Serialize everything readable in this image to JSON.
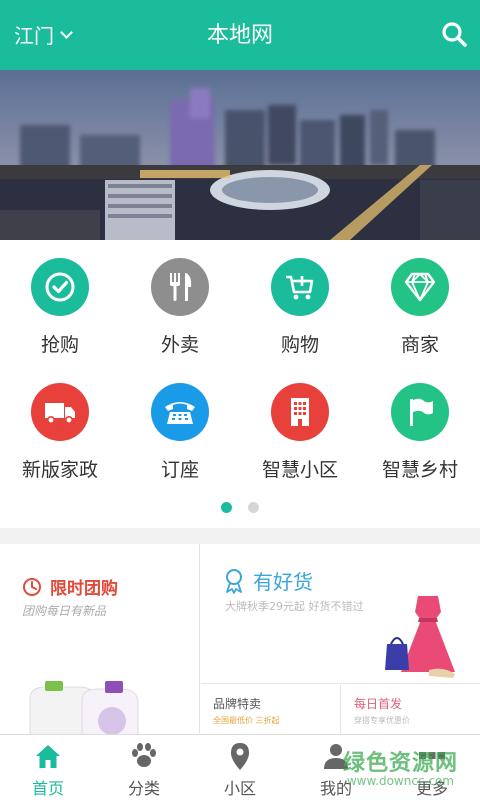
{
  "header": {
    "city": "江门",
    "title": "本地网",
    "bg_color": "#1bbc9b",
    "search_icon": "search-icon"
  },
  "categories": [
    {
      "label": "抢购",
      "icon": "check-icon",
      "color": "#1bbc9b"
    },
    {
      "label": "外卖",
      "icon": "fork-knife-icon",
      "color": "#8e8e8e"
    },
    {
      "label": "购物",
      "icon": "cart-icon",
      "color": "#1bbc9b"
    },
    {
      "label": "商家",
      "icon": "diamond-icon",
      "color": "#23c285"
    },
    {
      "label": "新版家政",
      "icon": "truck-icon",
      "color": "#e8413c"
    },
    {
      "label": "订座",
      "icon": "phone-icon",
      "color": "#1a9be8"
    },
    {
      "label": "智慧小区",
      "icon": "building-icon",
      "color": "#e8413c"
    },
    {
      "label": "智慧乡村",
      "icon": "flag-icon",
      "color": "#23c285"
    }
  ],
  "pager": {
    "count": 2,
    "active_index": 0
  },
  "promo": {
    "flash": {
      "title": "限时团购",
      "subtitle": "团购每日有新品"
    },
    "goods": {
      "title": "有好货",
      "subtitle": "大牌秋季29元起 好货不错过"
    },
    "brand": {
      "title": "品牌特卖",
      "subtitle": "全国最低价 三折起"
    },
    "daily": {
      "title": "每日首发",
      "subtitle": "穿搭专享优惠价"
    }
  },
  "tabs": [
    {
      "label": "首页",
      "icon": "home-icon",
      "active": true
    },
    {
      "label": "分类",
      "icon": "paw-icon",
      "active": false
    },
    {
      "label": "小区",
      "icon": "location-pin-icon",
      "active": false
    },
    {
      "label": "我的",
      "icon": "user-icon",
      "active": false
    },
    {
      "label": "更多",
      "icon": "more-icon",
      "active": false
    }
  ],
  "watermark": {
    "text": "绿色资源网",
    "url": "www.downcc.com"
  }
}
